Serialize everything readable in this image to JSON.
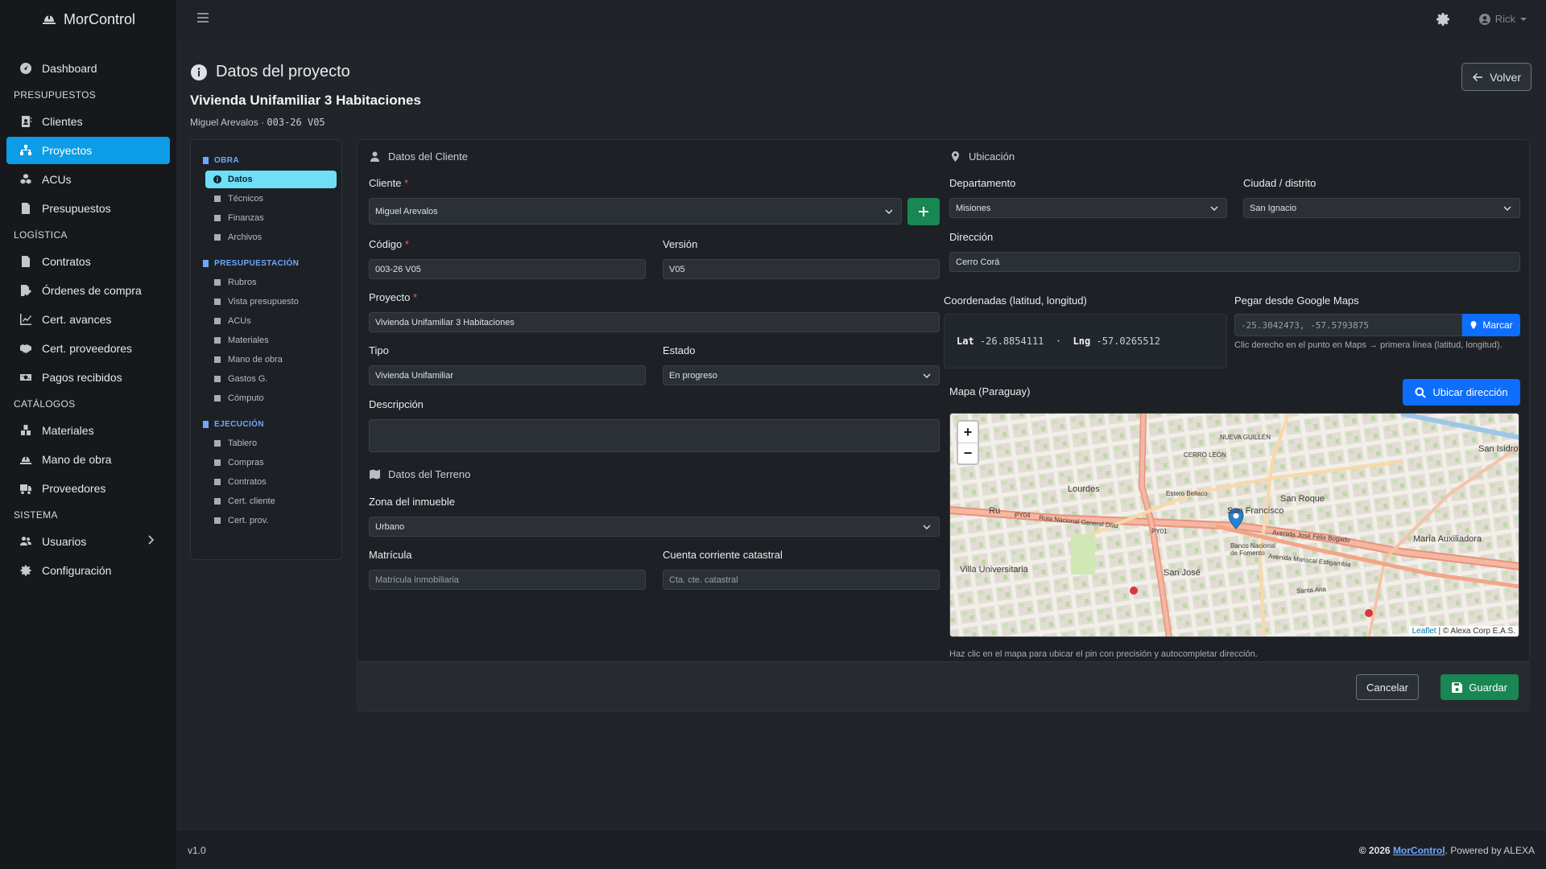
{
  "brand": {
    "name": "MorControl",
    "icon": "hard-hat-icon"
  },
  "sidebar": {
    "items": [
      {
        "type": "item",
        "label": "Dashboard",
        "icon": "gauge-icon",
        "name": "sidebar-item-dashboard"
      },
      {
        "type": "header",
        "label": "PRESUPUESTOS"
      },
      {
        "type": "item",
        "label": "Clientes",
        "icon": "contact-book-icon",
        "name": "sidebar-item-clientes"
      },
      {
        "type": "item",
        "label": "Proyectos",
        "icon": "sitemap-icon",
        "name": "sidebar-item-proyectos",
        "active": true
      },
      {
        "type": "item",
        "label": "ACUs",
        "icon": "cubes-icon",
        "name": "sidebar-item-acus"
      },
      {
        "type": "item",
        "label": "Presupuestos",
        "icon": "invoice-icon",
        "name": "sidebar-item-presupuestos"
      },
      {
        "type": "header",
        "label": "LOGÍSTICA"
      },
      {
        "type": "item",
        "label": "Contratos",
        "icon": "contract-icon",
        "name": "sidebar-item-contratos"
      },
      {
        "type": "item",
        "label": "Órdenes de compra",
        "icon": "file-pen-icon",
        "name": "sidebar-item-ordenes-compra"
      },
      {
        "type": "item",
        "label": "Cert. avances",
        "icon": "chart-line-icon",
        "name": "sidebar-item-cert-avances"
      },
      {
        "type": "item",
        "label": "Cert. proveedores",
        "icon": "handshake-icon",
        "name": "sidebar-item-cert-proveedores"
      },
      {
        "type": "item",
        "label": "Pagos recibidos",
        "icon": "money-bill-icon",
        "name": "sidebar-item-pagos-recibidos"
      },
      {
        "type": "header",
        "label": "CATÁLOGOS"
      },
      {
        "type": "item",
        "label": "Materiales",
        "icon": "boxes-icon",
        "name": "sidebar-item-materiales"
      },
      {
        "type": "item",
        "label": "Mano de obra",
        "icon": "hard-hat-icon",
        "name": "sidebar-item-mano-obra"
      },
      {
        "type": "item",
        "label": "Proveedores",
        "icon": "truck-icon",
        "name": "sidebar-item-proveedores"
      },
      {
        "type": "header",
        "label": "SISTEMA"
      },
      {
        "type": "item",
        "label": "Usuarios",
        "icon": "users-icon",
        "name": "sidebar-item-usuarios",
        "chevron": true
      },
      {
        "type": "item",
        "label": "Configuración",
        "icon": "gear-icon",
        "name": "sidebar-item-configuracion"
      }
    ]
  },
  "topbar": {
    "user": "Rick"
  },
  "page": {
    "title": "Datos del proyecto",
    "subtitle": "Vivienda Unifamiliar 3 Habitaciones",
    "meta_client": "Miguel Arevalos",
    "meta_sep": "·",
    "meta_code": "003-26 V05",
    "back_label": "Volver"
  },
  "subnav": {
    "sections": [
      {
        "label": "OBRA",
        "items": [
          "Datos",
          "Técnicos",
          "Finanzas",
          "Archivos"
        ]
      },
      {
        "label": "PRESUPUESTACIÓN",
        "items": [
          "Rubros",
          "Vista presupuesto",
          "ACUs",
          "Materiales",
          "Mano de obra",
          "Gastos G.",
          "Cómputo"
        ]
      },
      {
        "label": "EJECUCIÓN",
        "items": [
          "Tablero",
          "Compras",
          "Contratos",
          "Cert. cliente",
          "Cert. prov."
        ]
      }
    ],
    "active": "Datos"
  },
  "cliente": {
    "section_title": "Datos del Cliente",
    "cliente_label": "Cliente",
    "cliente_value": "Miguel Arevalos",
    "codigo_label": "Código",
    "codigo_value": "003-26 V05",
    "version_label": "Versión",
    "version_value": "V05",
    "proyecto_label": "Proyecto",
    "proyecto_value": "Vivienda Unifamiliar 3 Habitaciones",
    "tipo_label": "Tipo",
    "tipo_value": "Vivienda Unifamiliar",
    "estado_label": "Estado",
    "estado_value": "En progreso",
    "descripcion_label": "Descripción"
  },
  "terreno": {
    "section_title": "Datos del Terreno",
    "zona_label": "Zona del inmueble",
    "zona_value": "Urbano",
    "matricula_label": "Matrícula",
    "matricula_placeholder": "Matrícula inmobiliaria",
    "cuenta_label": "Cuenta corriente catastral",
    "cuenta_placeholder": "Cta. cte. catastral"
  },
  "ubicacion": {
    "section_title": "Ubicación",
    "departamento_label": "Departamento",
    "departamento_value": "Misiones",
    "ciudad_label": "Ciudad / distrito",
    "ciudad_value": "San Ignacio",
    "direccion_label": "Dirección",
    "direccion_value": "Cerro Corá",
    "coords_label": "Coordenadas (latitud, longitud)",
    "lat_label": "Lat",
    "lat_value": "-26.8854111",
    "lng_label": "Lng",
    "lng_value": "-57.0265512",
    "coord_sep": "·",
    "gmaps_label": "Pegar desde Google Maps",
    "gmaps_placeholder": "-25.3042473, -57.5793875",
    "marcar_label": "Marcar",
    "gmaps_help": "Clic derecho en el punto en Maps → primera línea (latitud, longitud).",
    "mapa_label": "Mapa (Paraguay)",
    "ubicar_label": "Ubicar dirección",
    "map_help": "Haz clic en el mapa para ubicar el pin con precisión y autocompletar dirección.",
    "zoom_in": "+",
    "zoom_out": "−",
    "attribution_link": "Leaflet",
    "attribution_text": "| © Alexa Corp E.A.S.",
    "map_labels": [
      "Lourdes",
      "Villa Universitaria",
      "San José",
      "San Roque",
      "María Auxiliadora",
      "San Isidro",
      "San Francisco",
      "Banco Nacional de Fomento",
      "Ruta Nacional General Díaz",
      "Avenida José Félix Bogado",
      "Avenida Mariscal Estigarribia",
      "Estero Bellaco",
      "PY04",
      "PY01",
      "Ru",
      "CERRO LEÓN",
      "NUEVA GUILLÉN",
      "Santa Ana"
    ]
  },
  "actions": {
    "cancel": "Cancelar",
    "save": "Guardar"
  },
  "footer": {
    "version": "v1.0",
    "copy_prefix": "© 2026",
    "copy_link": "MorControl",
    "copy_suffix": ". Powered by ALEXA"
  },
  "colors": {
    "primary": "#0d6efd",
    "active_nav": "#0d9ce6",
    "success": "#198754",
    "info_tab": "#6edff6",
    "required": "#e35d6a"
  }
}
